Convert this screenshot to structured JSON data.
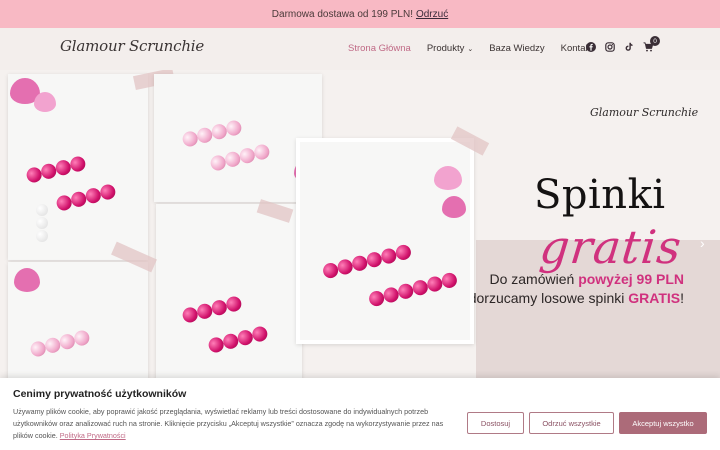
{
  "promo": {
    "text": "Darmowa dostawa od 199 PLN!",
    "link": "Odrzuć"
  },
  "header": {
    "logo": "Glamour Scrunchie",
    "nav": [
      {
        "label": "Strona Główna",
        "active": true
      },
      {
        "label": "Produkty",
        "dropdown": true
      },
      {
        "label": "Baza Wiedzy"
      },
      {
        "label": "Kontakt"
      }
    ],
    "icons": [
      "facebook-icon",
      "instagram-icon",
      "tiktok-icon",
      "cart-icon"
    ],
    "cart_count": "0"
  },
  "hero": {
    "logo": "Glamour Scrunchie",
    "headline": "Spinki",
    "script": "gratis",
    "offer_line1_prefix": "Do zamówień",
    "offer_line1_highlight": "powyżej 99 PLN",
    "offer_line2_prefix": "dorzucamy losowe spinki",
    "offer_line2_highlight": "GRATIS",
    "offer_line2_suffix": "!",
    "accent": "#d0317e"
  },
  "cookie": {
    "title": "Cenimy prywatność użytkowników",
    "text": "Używamy plików cookie, aby poprawić jakość przeglądania, wyświetlać reklamy lub treści dostosowane do indywidualnych potrzeb użytkowników oraz analizować ruch na stronie. Kliknięcie przycisku „Akceptuj wszystkie” oznacza zgodę na wykorzystywanie przez nas plików cookie.",
    "policy_link": "Polityka Prywatności",
    "customize": "Dostosuj",
    "reject": "Odrzuć wszystkie",
    "accept": "Akceptuj wszystko",
    "accent": "#ac6b79"
  }
}
